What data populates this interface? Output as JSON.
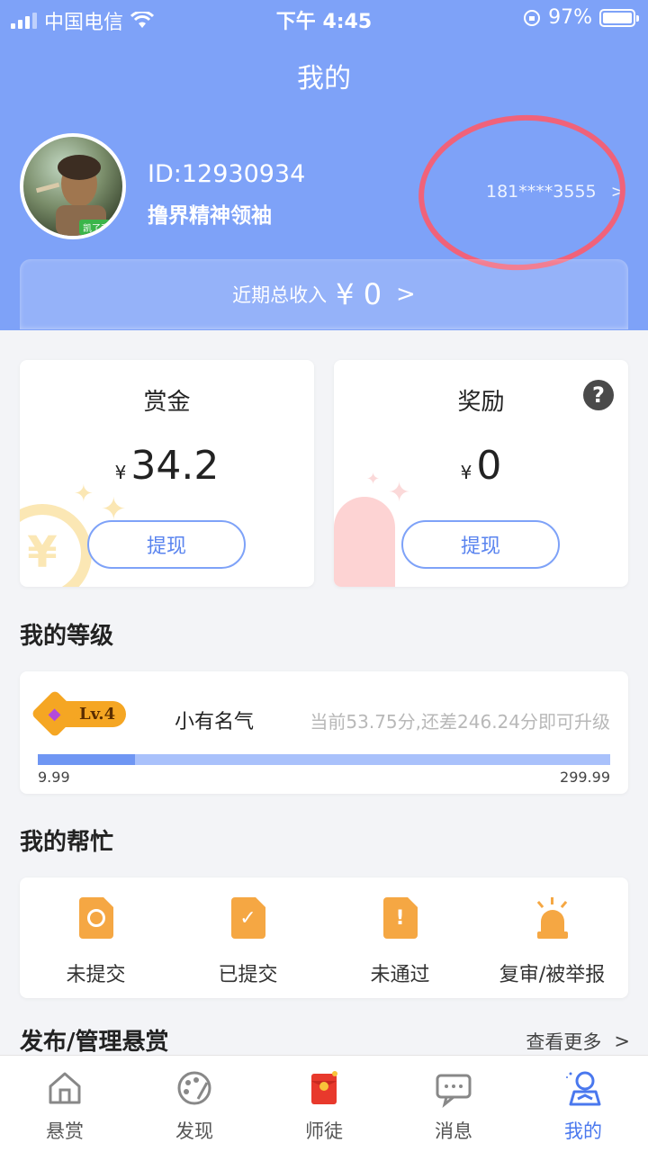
{
  "status_bar": {
    "carrier": "中国电信",
    "time": "下午 4:45",
    "battery": "97%"
  },
  "header": {
    "title": "我的"
  },
  "profile": {
    "id_text": "ID:12930934",
    "user_title": "撸界精神领袖",
    "avatar_badge": "凯了旁",
    "phone": "181****3555",
    "phone_chevron": ">"
  },
  "income": {
    "label": "近期总收入",
    "value": "¥ 0",
    "chevron": ">"
  },
  "bounty_card": {
    "title": "赏金",
    "currency": "¥",
    "amount": "34.2",
    "button": "提现"
  },
  "reward_card": {
    "title": "奖励",
    "currency": "¥",
    "amount": "0",
    "button": "提现",
    "help": "?"
  },
  "level_section": {
    "title": "我的等级",
    "badge": "Lv.4",
    "level_name": "小有名气",
    "description": "当前53.75分,还差246.24分即可升级",
    "range_min": "9.99",
    "range_max": "299.99",
    "progress_fraction": 0.17
  },
  "help_section": {
    "title": "我的帮忙",
    "items": [
      {
        "label": "未提交",
        "icon": "clock-document-icon"
      },
      {
        "label": "已提交",
        "icon": "check-document-icon"
      },
      {
        "label": "未通过",
        "icon": "exclamation-document-icon"
      },
      {
        "label": "复审/被举报",
        "icon": "alarm-light-icon"
      }
    ]
  },
  "publish_section": {
    "title": "发布/管理悬赏",
    "see_more": "查看更多",
    "chevron": ">"
  },
  "tabbar": {
    "items": [
      {
        "label": "悬赏",
        "icon": "house-icon"
      },
      {
        "label": "发现",
        "icon": "palette-icon"
      },
      {
        "label": "师徒",
        "icon": "red-envelope-icon"
      },
      {
        "label": "消息",
        "icon": "chat-bubble-icon"
      },
      {
        "label": "我的",
        "icon": "person-icon"
      }
    ],
    "active_index": 4
  },
  "colors": {
    "header_bg": "#7ea2f8",
    "accent": "#4a78ee",
    "orange": "#f5a743",
    "annotation": "#f0627a"
  }
}
